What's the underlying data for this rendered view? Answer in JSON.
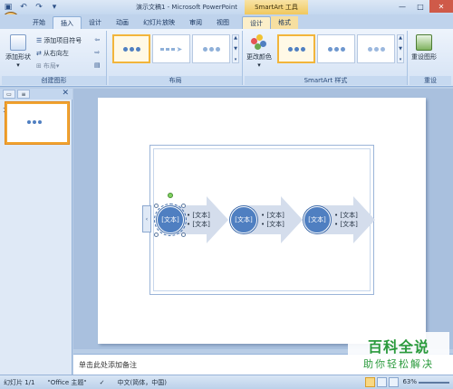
{
  "titlebar": {
    "doc_title": "演示文稿1 - Microsoft PowerPoint",
    "context_title": "SmartArt 工具",
    "qat_icons": [
      "save-icon",
      "undo-icon",
      "redo-icon",
      "dropdown-icon"
    ],
    "win": {
      "min": "—",
      "max": "□",
      "close": "✕"
    }
  },
  "tabs": [
    {
      "label": "开始"
    },
    {
      "label": "插入",
      "active": true
    },
    {
      "label": "设计"
    },
    {
      "label": "动画"
    },
    {
      "label": "幻灯片放映"
    },
    {
      "label": "审阅"
    },
    {
      "label": "视图"
    },
    {
      "label": "设计",
      "context": true
    },
    {
      "label": "格式",
      "context": true
    }
  ],
  "ribbon": {
    "create_group": {
      "label": "创建图形",
      "add_shape": "添加形状",
      "add_bullet": "添加项目符号",
      "right_to_left": "从右向左",
      "layout": "布局"
    },
    "layouts_group": {
      "label": "布局"
    },
    "styles_group": {
      "label": "SmartArt 样式",
      "change_colors": "更改颜色"
    },
    "reset_group": {
      "label": "重设",
      "reset_graphic": "重设图形"
    }
  },
  "left_panel": {
    "tab1": "▭",
    "tab2": "≡",
    "close": "✕",
    "slide_number": "1"
  },
  "slide": {
    "nodes": [
      {
        "circle": "[文本]",
        "bullets": [
          "• [文本]",
          "• [文本]"
        ]
      },
      {
        "circle": "[文本]",
        "bullets": [
          "• [文本]",
          "• [文本]"
        ]
      },
      {
        "circle": "[文本]",
        "bullets": [
          "• [文本]",
          "• [文本]"
        ]
      }
    ],
    "text_pane_arrow": "‹"
  },
  "notes": {
    "placeholder": "单击此处添加备注"
  },
  "watermark": {
    "line1": "百科全说",
    "line2": "助你轻松解决"
  },
  "status": {
    "slide_info": "幻灯片 1/1",
    "theme": "\"Office 主题\"",
    "language": "中文(简体，中国)",
    "zoom": "63%"
  },
  "colors": {
    "accent": "#4f7fc1",
    "context_tab": "#f6dfa0",
    "selection": "#f2b53b"
  }
}
